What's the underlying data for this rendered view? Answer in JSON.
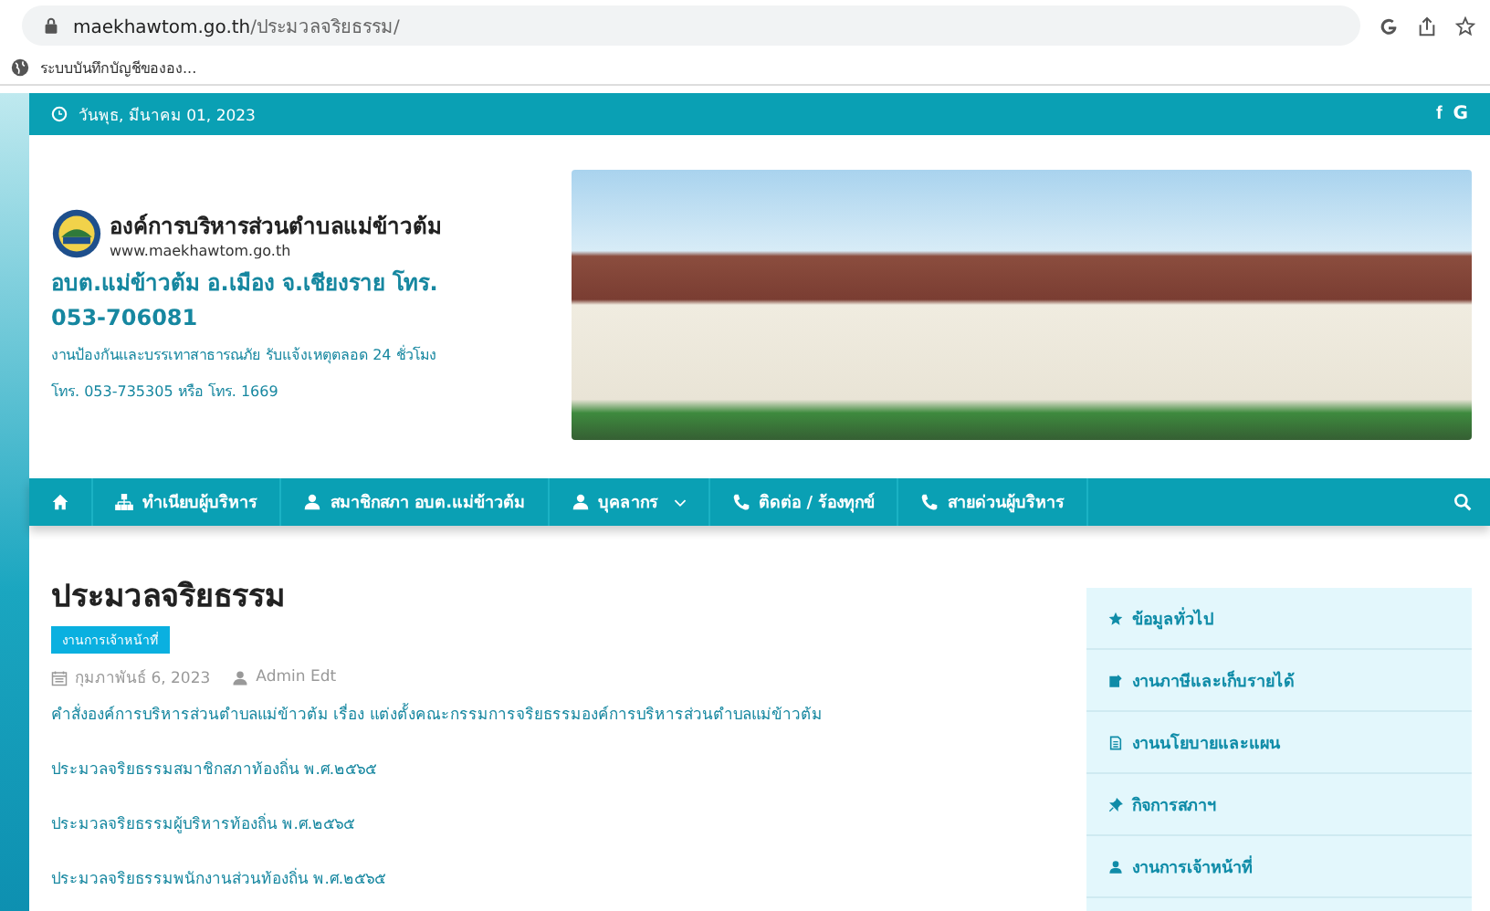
{
  "browser": {
    "url_host": "maekhawtom.go.th",
    "url_path": "/ประมวลจริยธรรม/",
    "bookmark": "ระบบบันทึกบัญชีขององ..."
  },
  "top_bar": {
    "date": "วันพุธ, มีนาคม 01, 2023",
    "social": [
      {
        "kind": "facebook",
        "label": "f"
      },
      {
        "kind": "google",
        "label": "G"
      }
    ]
  },
  "header": {
    "org_name": "องค์การบริหารส่วนตำบลแม่ข้าวต้ม",
    "website": "www.maekhawtom.go.th",
    "contact_line": "อบต.แม่ข้าวต้ม อ.เมือง จ.เชียงราย โทร.",
    "phone": "053-706081",
    "emergency": "งานป้องกันและบรรเทาสาธารณภัย รับแจ้งเหตุตลอด 24 ชั่วโมง",
    "emergency_phone": "โทร. 053-735305 หรือ โทร. 1669"
  },
  "nav": [
    {
      "kind": "home"
    },
    {
      "kind": "org",
      "label": "ทำเนียบผู้บริหาร"
    },
    {
      "kind": "person",
      "label": "สมาชิกสภา อบต.แม่ข้าวต้ม"
    },
    {
      "kind": "dropdown",
      "label": "บุคลากร"
    },
    {
      "kind": "phone",
      "label": "ติดต่อ / ร้องทุกข์"
    },
    {
      "kind": "phone",
      "label": "สายด่วนผู้บริหาร"
    }
  ],
  "article": {
    "title": "ประมวลจริยธรรม",
    "category": "งานการเจ้าหน้าที่",
    "date": "กุมภาพันธ์ 6, 2023",
    "author": "Admin Edt",
    "links": [
      "คำสั่งองค์การบริหารส่วนตำบลแม่ข้าวต้ม เรื่อง แต่งตั้งคณะกรรมการจริยธรรมองค์การบริหารส่วนตำบลแม่ข้าวต้ม",
      "ประมวลจริยธรรมสมาชิกสภาท้องถิ่น พ.ศ.๒๕๖๕",
      "ประมวลจริยธรรมผู้บริหารท้องถิ่น พ.ศ.๒๕๖๕",
      "ประมวลจริยธรรมพนักงานส่วนท้องถิ่น พ.ศ.๒๕๖๕"
    ]
  },
  "sidebar": {
    "items": [
      {
        "kind": "star",
        "label": "ข้อมูลทั่วไป"
      },
      {
        "kind": "edit",
        "label": "งานภาษีและเก็บรายได้"
      },
      {
        "kind": "doc",
        "label": "งานนโยบายและแผน"
      },
      {
        "kind": "pin",
        "label": "กิจการสภาฯ"
      },
      {
        "kind": "person",
        "label": "งานการเจ้าหน้าที่"
      }
    ]
  }
}
